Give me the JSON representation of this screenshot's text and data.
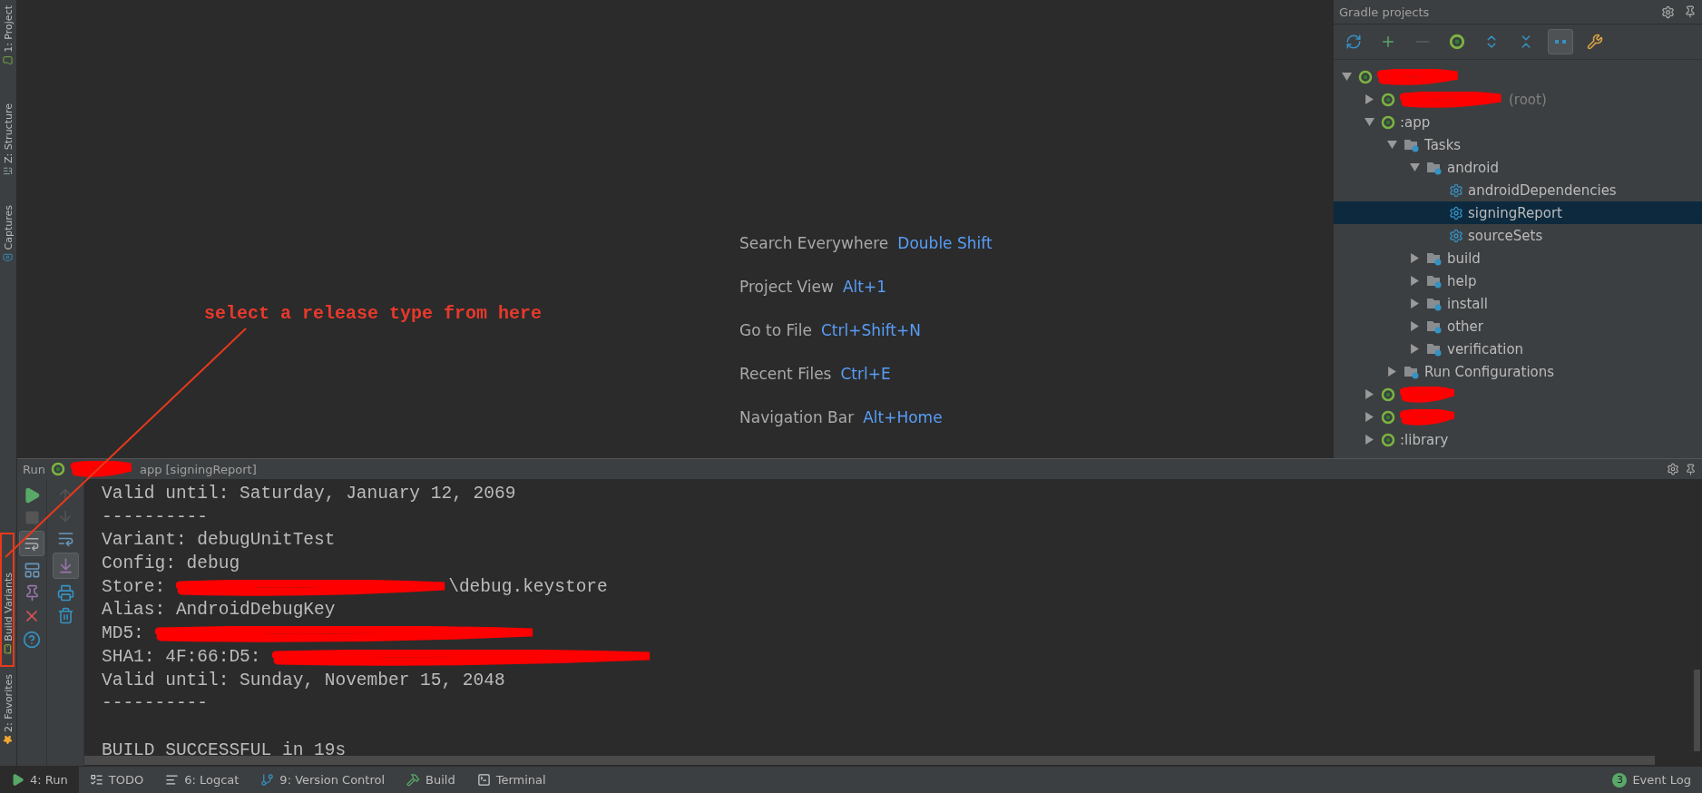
{
  "left_strip": {
    "tabs": [
      {
        "label": "1: Project",
        "kind": "project",
        "selected": false
      },
      {
        "label": "Z: Structure",
        "kind": "structure",
        "selected": false
      },
      {
        "label": "Captures",
        "kind": "captures",
        "selected": false
      },
      {
        "label": "Build Variants",
        "kind": "variants",
        "selected": false
      },
      {
        "label": "2: Favorites",
        "kind": "favorites",
        "selected": false
      }
    ]
  },
  "editor": {
    "hints": [
      {
        "label": "Search Everywhere",
        "shortcut": "Double Shift"
      },
      {
        "label": "Project View",
        "shortcut": "Alt+1"
      },
      {
        "label": "Go to File",
        "shortcut": "Ctrl+Shift+N"
      },
      {
        "label": "Recent Files",
        "shortcut": "Ctrl+E"
      },
      {
        "label": "Navigation Bar",
        "shortcut": "Alt+Home"
      }
    ]
  },
  "annotation": {
    "text": "select a release type from here"
  },
  "gradle": {
    "title": "Gradle projects",
    "tree": [
      {
        "kind": "module",
        "redacted": true,
        "expanded": true,
        "selected": false,
        "children": [
          {
            "kind": "module",
            "redacted": true,
            "suffix": "(root)",
            "expanded": false,
            "selected": false
          },
          {
            "kind": "module",
            "label": ":app",
            "redacted": false,
            "expanded": true,
            "selected": false,
            "children": [
              {
                "kind": "folder",
                "label": "Tasks",
                "expanded": true,
                "selected": false,
                "children": [
                  {
                    "kind": "folder",
                    "label": "android",
                    "expanded": true,
                    "selected": false,
                    "children": [
                      {
                        "kind": "task",
                        "label": "androidDependencies",
                        "selected": false
                      },
                      {
                        "kind": "task",
                        "label": "signingReport",
                        "selected": true
                      },
                      {
                        "kind": "task",
                        "label": "sourceSets",
                        "selected": false
                      }
                    ]
                  },
                  {
                    "kind": "folder",
                    "label": "build",
                    "expanded": false,
                    "selected": false
                  },
                  {
                    "kind": "folder",
                    "label": "help",
                    "expanded": false,
                    "selected": false
                  },
                  {
                    "kind": "folder",
                    "label": "install",
                    "expanded": false,
                    "selected": false
                  },
                  {
                    "kind": "folder",
                    "label": "other",
                    "expanded": false,
                    "selected": false
                  },
                  {
                    "kind": "folder",
                    "label": "verification",
                    "expanded": false,
                    "selected": false
                  }
                ]
              },
              {
                "kind": "folder",
                "label": "Run Configurations",
                "expanded": false,
                "selected": false
              }
            ]
          },
          {
            "kind": "module",
            "redacted": true,
            "expanded": false,
            "selected": false
          },
          {
            "kind": "module",
            "redacted": true,
            "expanded": false,
            "selected": false
          },
          {
            "kind": "module",
            "label": ":library",
            "redacted": false,
            "expanded": false,
            "selected": false
          }
        ]
      }
    ]
  },
  "run": {
    "label": "Run",
    "config": "app [signingReport]",
    "console": [
      {
        "text": "Valid until: Saturday, January 12, 2069",
        "redacted": false
      },
      {
        "text": "----------",
        "redacted": false
      },
      {
        "text": "Variant: debugUnitTest",
        "redacted": false
      },
      {
        "text": "Config: debug",
        "redacted": false
      },
      {
        "text": "Store:",
        "redacted": true,
        "tail": "\\debug.keystore"
      },
      {
        "text": "Alias: AndroidDebugKey",
        "redacted": false
      },
      {
        "text": "MD5:",
        "redacted": true
      },
      {
        "text": "SHA1: 4F:66:D5:",
        "redacted": true
      },
      {
        "text": "Valid until: Sunday, November 15, 2048",
        "redacted": false
      },
      {
        "text": "----------",
        "redacted": false
      },
      {
        "redacted": false
      },
      {
        "text": "BUILD SUCCESSFUL in 19s",
        "redacted": false
      }
    ]
  },
  "status_bar": {
    "tabs": [
      {
        "label": "4: Run",
        "kind": "run",
        "selected": true
      },
      {
        "label": "TODO",
        "kind": "todo",
        "selected": false
      },
      {
        "label": "6: Logcat",
        "kind": "logcat",
        "selected": false
      },
      {
        "label": "9: Version Control",
        "kind": "vcs",
        "selected": false
      },
      {
        "label": "Build",
        "kind": "build",
        "selected": false
      },
      {
        "label": "Terminal",
        "kind": "terminal",
        "selected": false
      }
    ],
    "event_log": {
      "label": "Event Log",
      "count": "3"
    }
  }
}
